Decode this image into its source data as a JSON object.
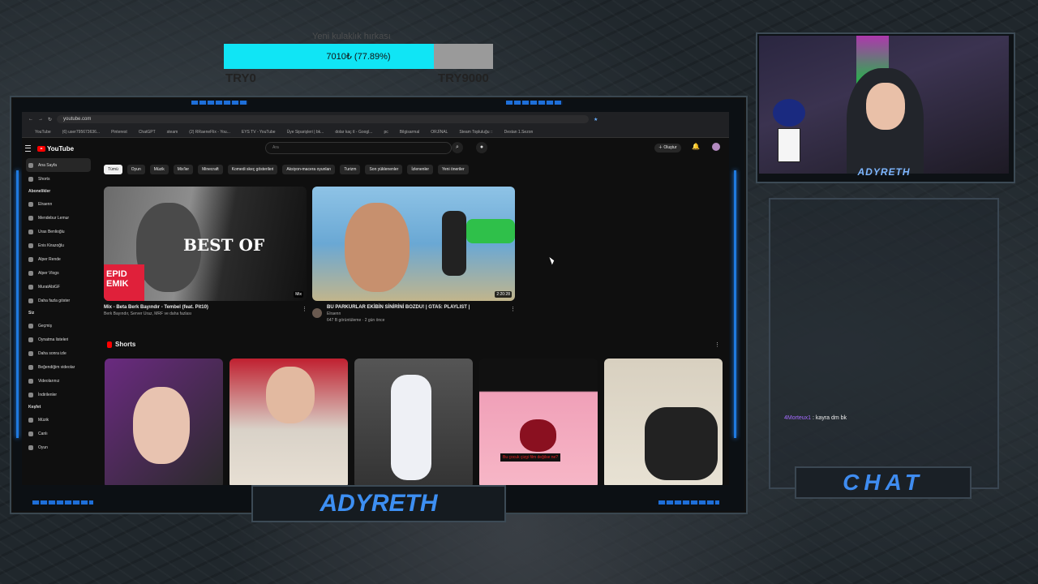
{
  "goal": {
    "title": "Yeni kulaklık hırkası",
    "progress_text": "7010₺ (77.89%)",
    "progress": 0.7789,
    "min_label": "TRY0",
    "max_label": "TRY9000",
    "color": "#10e5f5"
  },
  "browser": {
    "url": "youtube.com",
    "bookmarks": [
      "YouTube",
      "(6) user795673636...",
      "Pinterest",
      "ChatGPT",
      "steam",
      "(2) RRaeneFlix - You...",
      "EYS TV - YouTube",
      "Üye Siparişleri | bk...",
      "dolar kaç tl - Googl...",
      "pc",
      "Bilgisarmal",
      "ORJİNAL",
      "Steam Topluluğu ::",
      "Destan 1.Sezon"
    ]
  },
  "youtube": {
    "logo": "YouTube",
    "search_placeholder": "Ara",
    "create_label": "Oluştur",
    "sidebar": {
      "main": [
        {
          "label": "Ana Sayfa",
          "icon": "home-icon"
        },
        {
          "label": "Shorts",
          "icon": "shorts-icon"
        }
      ],
      "subs_title": "Abonelikler",
      "subs": [
        "Elraenn",
        "Mendebur Lemur",
        "Uras Benlioğlu",
        "Enis Kirazoğlu",
        "Alper Rende",
        "Alper Vlogs",
        "MuratAbiGF",
        "Daha fazla göster"
      ],
      "you_title": "Siz",
      "you": [
        "Geçmiş",
        "Oynatma listeleri",
        "Daha sonra izle",
        "Beğendiğim videolar",
        "Videolarınız",
        "İndirilenler"
      ],
      "explore_title": "Keşfet",
      "explore": [
        "Müzik",
        "Canlı",
        "Oyun"
      ]
    },
    "chips": [
      "Tümü",
      "Oyun",
      "Müzik",
      "Mix'ler",
      "Minecraft",
      "Komedi skeç gösterileri",
      "Aksiyon-macera oyunları",
      "Turizm",
      "Son yüklenenler",
      "İzlenenler",
      "Yeni öneriler"
    ],
    "videos": [
      {
        "title": "Mix - Beta Berk Bayındır - Tembel (feat. Pit10)",
        "meta": "Berk Bayındır, Server Uraz, MRF ve daha fazlası",
        "badge": "Mix",
        "thumb_text": "BEST OF",
        "thumb_corner": "EPID EMIK"
      },
      {
        "title": "BU PARKURLAR EKİBİN SİNİRİNİ BOZDU! | GTA5: PLAYLIST |",
        "channel": "Elraenn",
        "views": "647 B görüntüleme · 2 gün önce",
        "duration": "2:20:28"
      }
    ],
    "shorts_title": "Shorts",
    "short_caption": "Bu çocuk çizgi film değilse ne?"
  },
  "stream": {
    "cam_name": "ADYRETH",
    "chat_label": "CHAT",
    "bottom_name": "ADYRETH",
    "chat": [
      {
        "user": "4Morteux1",
        "text": ": kayra dm bk"
      }
    ],
    "accent": "#3d8ff2"
  }
}
